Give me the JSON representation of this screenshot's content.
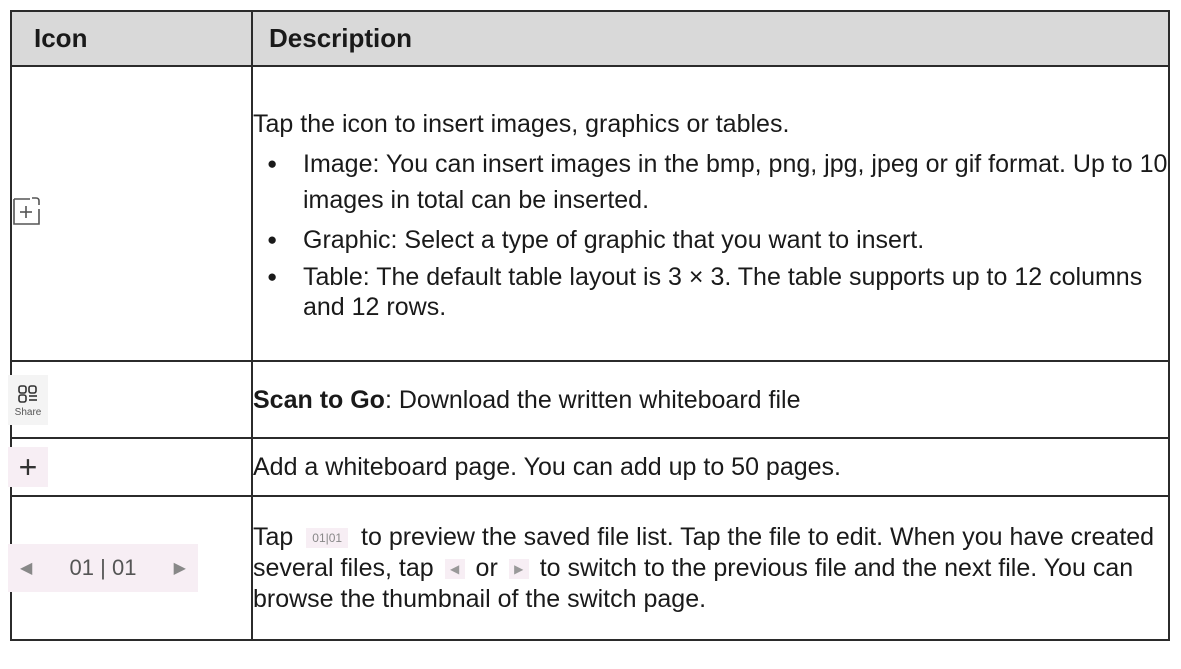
{
  "header": {
    "col_icon": "Icon",
    "col_description": "Description"
  },
  "rows": [
    {
      "icon": "insert-icon",
      "intro": "Tap the icon to insert images, graphics or tables.",
      "bullets": [
        "Image: You can insert images in the bmp, png, jpg, jpeg or gif format. Up to 10 images in total can be inserted.",
        "Graphic: Select a type of graphic that you want to insert.",
        "Table: The default table layout is 3 × 3. The table supports up to 12 columns and 12 rows."
      ]
    },
    {
      "icon": "qr-share-icon",
      "icon_label": "Share",
      "bold": "Scan to Go",
      "text": ": Download the written whiteboard file"
    },
    {
      "icon": "plus-icon",
      "text": "Add a whiteboard page. You can add up to 50 pages."
    },
    {
      "icon": "pager-icon",
      "pager_label": "01 | 01",
      "mini_label": "01|01",
      "p1": "Tap",
      "p2": "to preview the saved file list. Tap the file to edit. When you have created several files, tap",
      "p3": "or",
      "p4": "to switch to the previous file and the next file. You can browse the thumbnail of the switch page."
    }
  ]
}
